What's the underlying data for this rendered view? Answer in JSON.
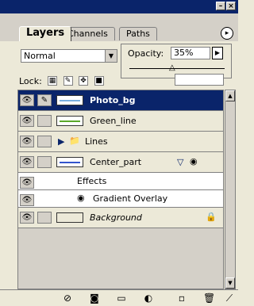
{
  "window": {
    "minimize_label": "–",
    "close_label": "×"
  },
  "tabs": [
    {
      "label": "Layers"
    },
    {
      "label": "Channels"
    },
    {
      "label": "Paths"
    }
  ],
  "toolbar": {
    "blend_mode": "Normal",
    "opacity_label": "Opacity:",
    "opacity_value": "35%",
    "opacity_fraction": 0.35,
    "lock_label": "Lock:"
  },
  "layers": [
    {
      "name": "Photo_bg",
      "selected": true
    },
    {
      "name": "Green_line"
    },
    {
      "name": "Lines"
    },
    {
      "name": "Center_part"
    },
    {
      "name": "Background"
    }
  ],
  "effects": {
    "header": "Effects",
    "items": [
      {
        "label": "Gradient Overlay"
      }
    ]
  },
  "colors": {
    "accent": "#0a246a",
    "green_line": "#5aa829",
    "center_line": "#3355cc"
  }
}
